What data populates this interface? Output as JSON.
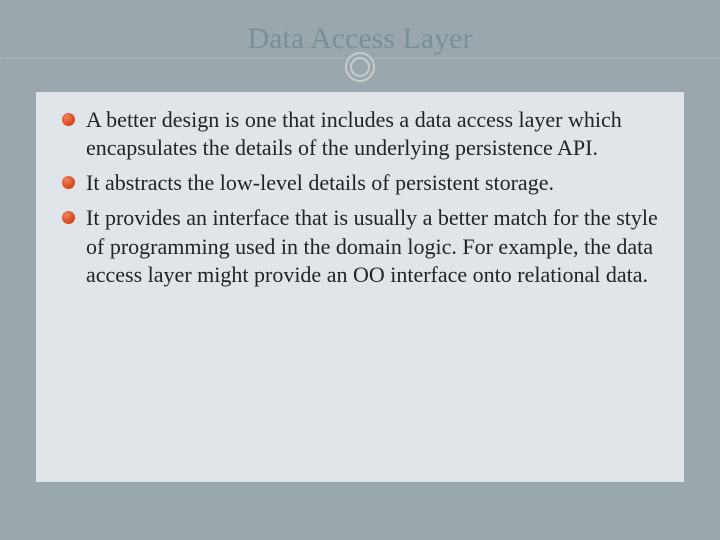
{
  "title": "Data Access Layer",
  "bullets": [
    "A better design is one that includes a data access layer which encapsulates the details of the underlying persistence API.",
    "It abstracts the low-level details of persistent storage.",
    "It provides an interface that is usually a better match for the style of programming used in the domain logic. For example, the data access layer might provide an OO interface onto relational data."
  ]
}
